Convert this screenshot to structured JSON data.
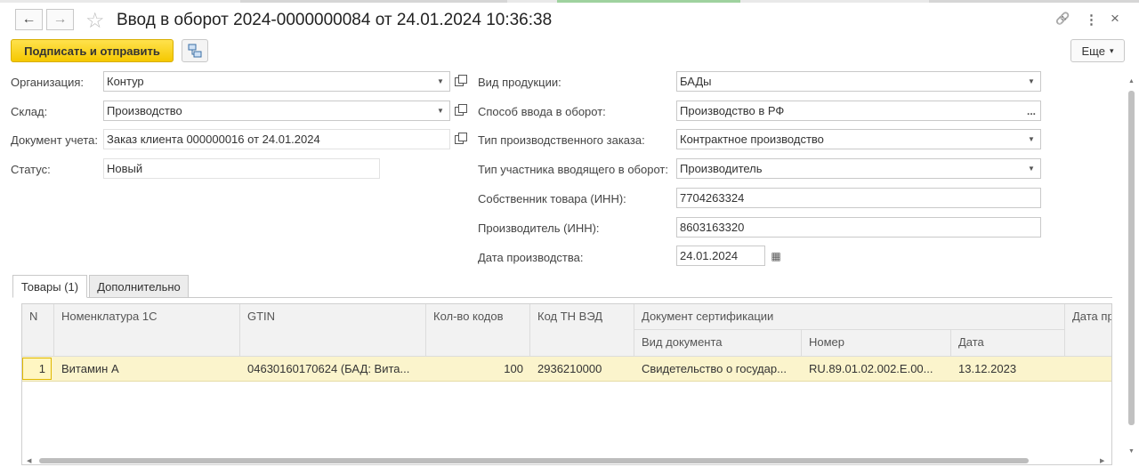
{
  "header": {
    "title": "Ввод в оборот 2024-0000000084 от 24.01.2024 10:36:38",
    "back_icon": "←",
    "forward_icon": "→",
    "star_icon": "☆",
    "link_icon": "🔗",
    "menu_icon": "⋮",
    "close_icon": "×"
  },
  "toolbar": {
    "sign_send_label": "Подписать и отправить",
    "more_label": "Еще",
    "more_arrow": "▾"
  },
  "left_fields": [
    {
      "label": "Организация:",
      "value": "Контур"
    },
    {
      "label": "Склад:",
      "value": "Производство"
    },
    {
      "label": "Документ учета:",
      "value": "Заказ клиента 000000016 от 24.01.2024"
    },
    {
      "label": "Статус:",
      "value": "Новый"
    }
  ],
  "right_fields": [
    {
      "label": "Вид продукции:",
      "value": "БАДы"
    },
    {
      "label": "Способ ввода в оборот:",
      "value": "Производство в РФ"
    },
    {
      "label": "Тип производственного заказа:",
      "value": "Контрактное производство"
    },
    {
      "label": "Тип участника вводящего в оборот:",
      "value": "Производитель"
    },
    {
      "label": "Собственник товара (ИНН):",
      "value": "7704263324"
    },
    {
      "label": "Производитель (ИНН):",
      "value": "8603163320"
    },
    {
      "label": "Дата производства:",
      "value": "24.01.2024"
    }
  ],
  "ui_glyphs": {
    "dropdown": "▼",
    "ellipsis": "...",
    "calendar": "▦"
  },
  "tabs": [
    {
      "label": "Товары (1)",
      "active": true
    },
    {
      "label": "Дополнительно",
      "active": false
    }
  ],
  "table": {
    "headers": {
      "n": "N",
      "nomenclature": "Номенклатура 1С",
      "gtin": "GTIN",
      "codes_qty": "Кол-во кодов",
      "tn_ved": "Код ТН ВЭД",
      "cert_doc": "Документ сертификации",
      "doc_type": "Вид документа",
      "number": "Номер",
      "date": "Дата",
      "prod_date": "Дата пр"
    },
    "rows": [
      {
        "n": "1",
        "nomenclature": "Витамин А",
        "gtin": "04630160170624 (БАД: Вита...",
        "codes_qty": "100",
        "tn_ved": "2936210000",
        "doc_type": "Свидетельство о государ...",
        "number": "RU.89.01.02.002.E.00...",
        "date": "13.12.2023"
      }
    ]
  },
  "scroll_glyphs": {
    "up": "▲",
    "down": "▼",
    "left": "◀",
    "right": "▶"
  }
}
